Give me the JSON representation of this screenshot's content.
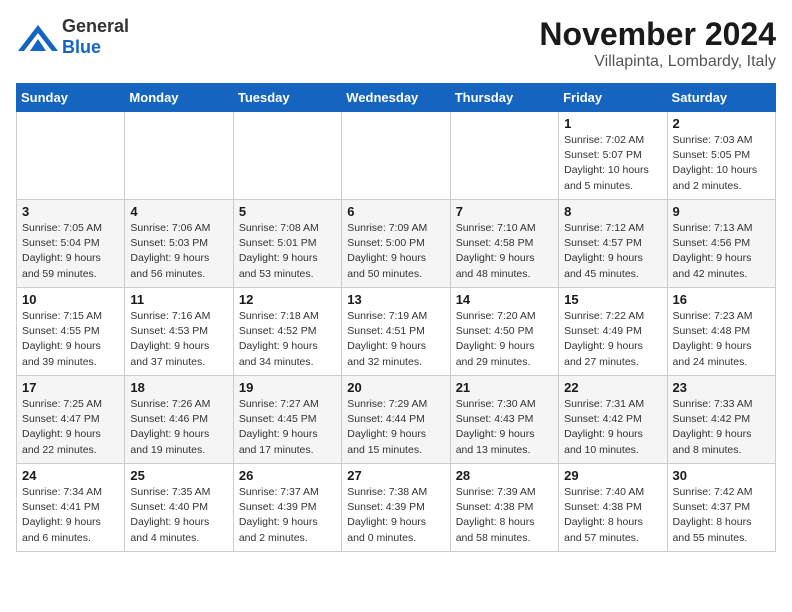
{
  "header": {
    "logo_general": "General",
    "logo_blue": "Blue",
    "title": "November 2024",
    "subtitle": "Villapinta, Lombardy, Italy"
  },
  "calendar": {
    "days_of_week": [
      "Sunday",
      "Monday",
      "Tuesday",
      "Wednesday",
      "Thursday",
      "Friday",
      "Saturday"
    ],
    "weeks": [
      [
        {
          "day": "",
          "info": ""
        },
        {
          "day": "",
          "info": ""
        },
        {
          "day": "",
          "info": ""
        },
        {
          "day": "",
          "info": ""
        },
        {
          "day": "",
          "info": ""
        },
        {
          "day": "1",
          "info": "Sunrise: 7:02 AM\nSunset: 5:07 PM\nDaylight: 10 hours\nand 5 minutes."
        },
        {
          "day": "2",
          "info": "Sunrise: 7:03 AM\nSunset: 5:05 PM\nDaylight: 10 hours\nand 2 minutes."
        }
      ],
      [
        {
          "day": "3",
          "info": "Sunrise: 7:05 AM\nSunset: 5:04 PM\nDaylight: 9 hours\nand 59 minutes."
        },
        {
          "day": "4",
          "info": "Sunrise: 7:06 AM\nSunset: 5:03 PM\nDaylight: 9 hours\nand 56 minutes."
        },
        {
          "day": "5",
          "info": "Sunrise: 7:08 AM\nSunset: 5:01 PM\nDaylight: 9 hours\nand 53 minutes."
        },
        {
          "day": "6",
          "info": "Sunrise: 7:09 AM\nSunset: 5:00 PM\nDaylight: 9 hours\nand 50 minutes."
        },
        {
          "day": "7",
          "info": "Sunrise: 7:10 AM\nSunset: 4:58 PM\nDaylight: 9 hours\nand 48 minutes."
        },
        {
          "day": "8",
          "info": "Sunrise: 7:12 AM\nSunset: 4:57 PM\nDaylight: 9 hours\nand 45 minutes."
        },
        {
          "day": "9",
          "info": "Sunrise: 7:13 AM\nSunset: 4:56 PM\nDaylight: 9 hours\nand 42 minutes."
        }
      ],
      [
        {
          "day": "10",
          "info": "Sunrise: 7:15 AM\nSunset: 4:55 PM\nDaylight: 9 hours\nand 39 minutes."
        },
        {
          "day": "11",
          "info": "Sunrise: 7:16 AM\nSunset: 4:53 PM\nDaylight: 9 hours\nand 37 minutes."
        },
        {
          "day": "12",
          "info": "Sunrise: 7:18 AM\nSunset: 4:52 PM\nDaylight: 9 hours\nand 34 minutes."
        },
        {
          "day": "13",
          "info": "Sunrise: 7:19 AM\nSunset: 4:51 PM\nDaylight: 9 hours\nand 32 minutes."
        },
        {
          "day": "14",
          "info": "Sunrise: 7:20 AM\nSunset: 4:50 PM\nDaylight: 9 hours\nand 29 minutes."
        },
        {
          "day": "15",
          "info": "Sunrise: 7:22 AM\nSunset: 4:49 PM\nDaylight: 9 hours\nand 27 minutes."
        },
        {
          "day": "16",
          "info": "Sunrise: 7:23 AM\nSunset: 4:48 PM\nDaylight: 9 hours\nand 24 minutes."
        }
      ],
      [
        {
          "day": "17",
          "info": "Sunrise: 7:25 AM\nSunset: 4:47 PM\nDaylight: 9 hours\nand 22 minutes."
        },
        {
          "day": "18",
          "info": "Sunrise: 7:26 AM\nSunset: 4:46 PM\nDaylight: 9 hours\nand 19 minutes."
        },
        {
          "day": "19",
          "info": "Sunrise: 7:27 AM\nSunset: 4:45 PM\nDaylight: 9 hours\nand 17 minutes."
        },
        {
          "day": "20",
          "info": "Sunrise: 7:29 AM\nSunset: 4:44 PM\nDaylight: 9 hours\nand 15 minutes."
        },
        {
          "day": "21",
          "info": "Sunrise: 7:30 AM\nSunset: 4:43 PM\nDaylight: 9 hours\nand 13 minutes."
        },
        {
          "day": "22",
          "info": "Sunrise: 7:31 AM\nSunset: 4:42 PM\nDaylight: 9 hours\nand 10 minutes."
        },
        {
          "day": "23",
          "info": "Sunrise: 7:33 AM\nSunset: 4:42 PM\nDaylight: 9 hours\nand 8 minutes."
        }
      ],
      [
        {
          "day": "24",
          "info": "Sunrise: 7:34 AM\nSunset: 4:41 PM\nDaylight: 9 hours\nand 6 minutes."
        },
        {
          "day": "25",
          "info": "Sunrise: 7:35 AM\nSunset: 4:40 PM\nDaylight: 9 hours\nand 4 minutes."
        },
        {
          "day": "26",
          "info": "Sunrise: 7:37 AM\nSunset: 4:39 PM\nDaylight: 9 hours\nand 2 minutes."
        },
        {
          "day": "27",
          "info": "Sunrise: 7:38 AM\nSunset: 4:39 PM\nDaylight: 9 hours\nand 0 minutes."
        },
        {
          "day": "28",
          "info": "Sunrise: 7:39 AM\nSunset: 4:38 PM\nDaylight: 8 hours\nand 58 minutes."
        },
        {
          "day": "29",
          "info": "Sunrise: 7:40 AM\nSunset: 4:38 PM\nDaylight: 8 hours\nand 57 minutes."
        },
        {
          "day": "30",
          "info": "Sunrise: 7:42 AM\nSunset: 4:37 PM\nDaylight: 8 hours\nand 55 minutes."
        }
      ]
    ]
  }
}
